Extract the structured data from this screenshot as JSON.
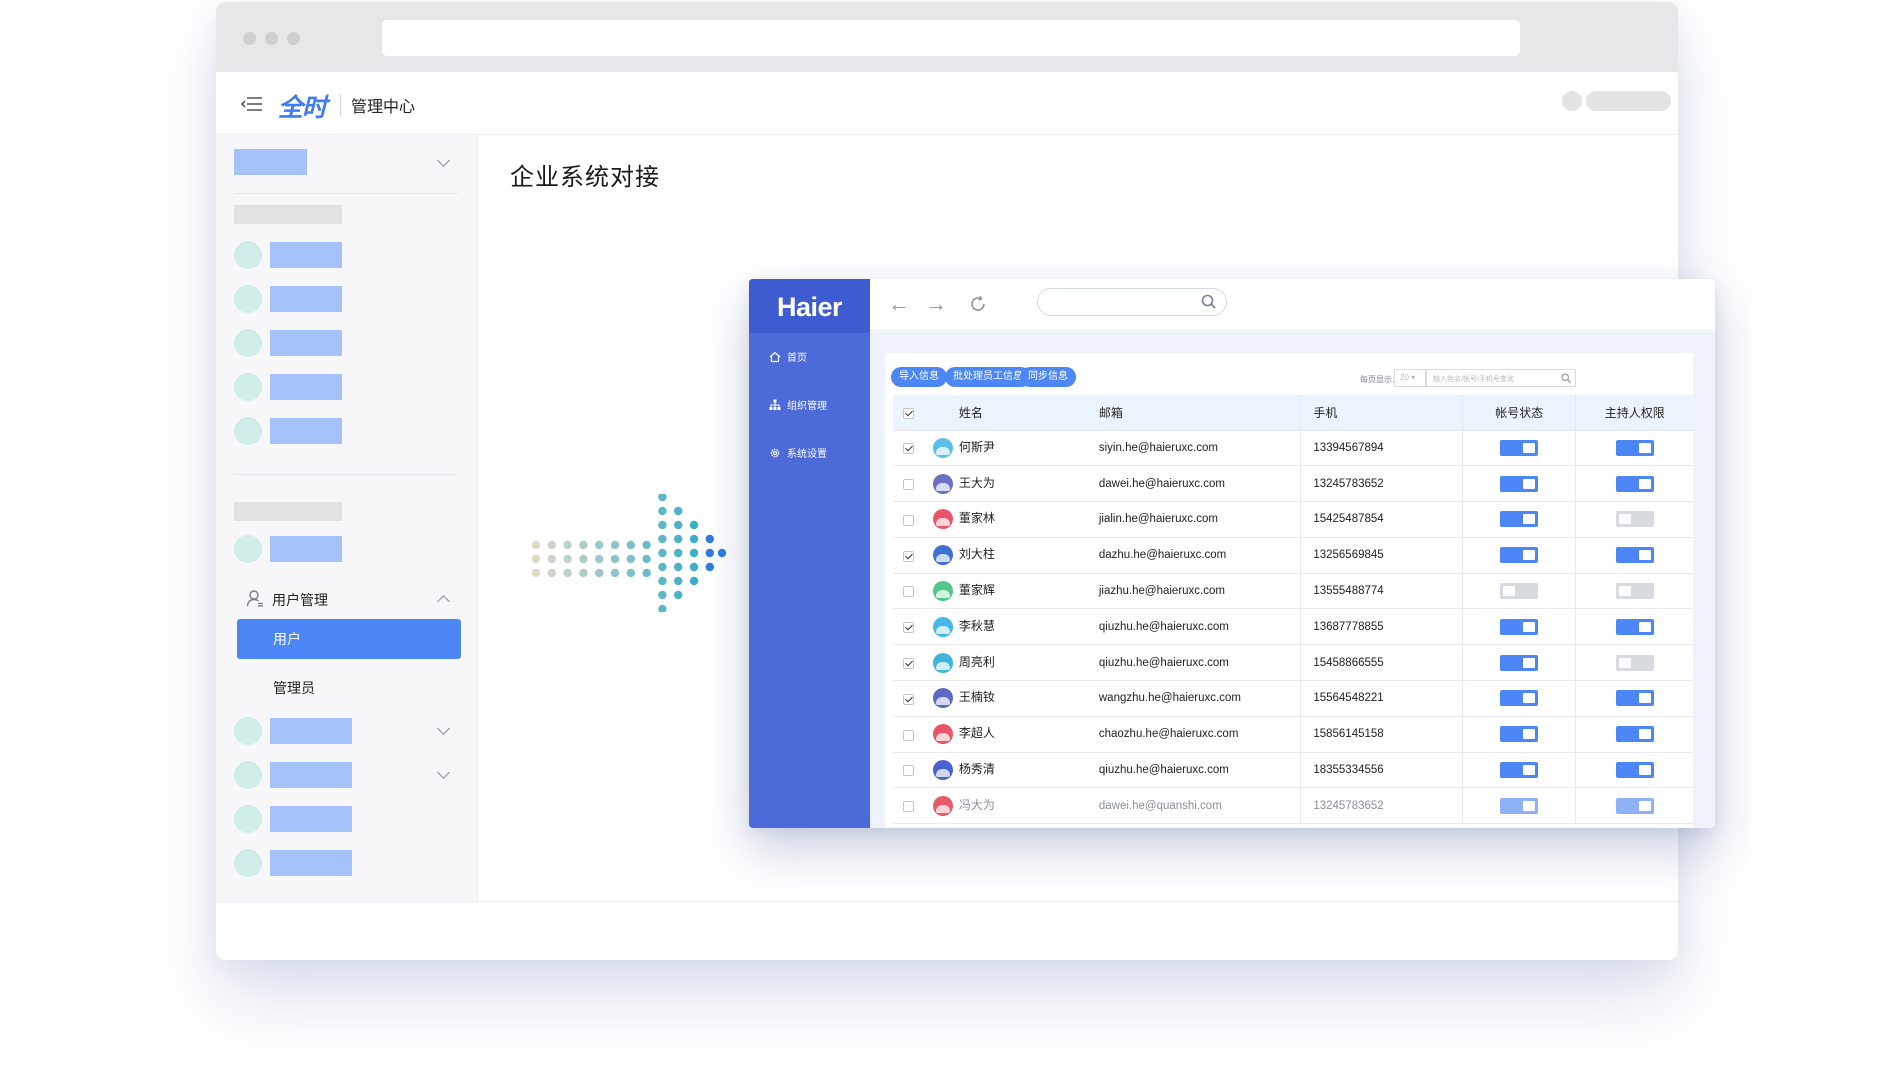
{
  "header": {
    "logo_text": "全时",
    "title": "管理中心"
  },
  "sidebar": {
    "user_mgmt_label": "用户管理",
    "active_item_label": "用户",
    "sub_item_label": "管理员"
  },
  "main": {
    "page_title": "企业系统对接"
  },
  "inner_app": {
    "logo": "Haier",
    "nav": [
      {
        "label": "首页",
        "icon": "home-icon"
      },
      {
        "label": "组织管理",
        "icon": "org-tree-icon"
      },
      {
        "label": "系统设置",
        "icon": "gear-icon"
      }
    ],
    "actions": [
      "导入信息",
      "批处理员工信息",
      "同步信息"
    ],
    "per_page_label": "每页显示：",
    "per_page_value": "20",
    "search_placeholder": "输入姓名/帐号/手机号查询",
    "columns": [
      "姓名",
      "邮箱",
      "手机",
      "帐号状态",
      "主持人权限"
    ],
    "rows": [
      {
        "checked": true,
        "name": "何斯尹",
        "email": "siyin.he@haieruxc.com",
        "phone": "13394567894",
        "account": true,
        "host": true,
        "avatar": "#5cc0e6"
      },
      {
        "checked": false,
        "name": "王大为",
        "email": "dawei.he@haieruxc.com",
        "phone": "13245783652",
        "account": true,
        "host": true,
        "avatar": "#6a6fc4"
      },
      {
        "checked": false,
        "name": "董家林",
        "email": "jialin.he@haieruxc.com",
        "phone": "15425487854",
        "account": true,
        "host": false,
        "avatar": "#e8556a"
      },
      {
        "checked": true,
        "name": "刘大柱",
        "email": "dazhu.he@haieruxc.com",
        "phone": "13256569845",
        "account": true,
        "host": true,
        "avatar": "#3e6fd6"
      },
      {
        "checked": false,
        "name": "董家辉",
        "email": "jiazhu.he@haieruxc.com",
        "phone": "13555488774",
        "account": false,
        "host": false,
        "avatar": "#52c78a"
      },
      {
        "checked": true,
        "name": "李秋慧",
        "email": "qiuzhu.he@haieruxc.com",
        "phone": "13687778855",
        "account": true,
        "host": true,
        "avatar": "#45b8e8"
      },
      {
        "checked": true,
        "name": "周亮利",
        "email": "qiuzhu.he@haieruxc.com",
        "phone": "15458866555",
        "account": true,
        "host": false,
        "avatar": "#3fb5d9"
      },
      {
        "checked": true,
        "name": "王楠钕",
        "email": "wangzhu.he@haieruxc.com",
        "phone": "15564548221",
        "account": true,
        "host": true,
        "avatar": "#5a69c6"
      },
      {
        "checked": false,
        "name": "李超人",
        "email": "chaozhu.he@haieruxc.com",
        "phone": "15856145158",
        "account": true,
        "host": true,
        "avatar": "#ea5463"
      },
      {
        "checked": false,
        "name": "杨秀清",
        "email": "qiuzhu.he@haieruxc.com",
        "phone": "18355334556",
        "account": true,
        "host": true,
        "avatar": "#4a62d0"
      },
      {
        "checked": false,
        "name": "冯大为",
        "email": "dawei.he@quanshi.com",
        "phone": "13245783652",
        "account": true,
        "host": true,
        "avatar": "#e85a6a"
      }
    ]
  },
  "colors": {
    "accent": "#4d86f5",
    "haier_sidebar": "#4d6ad9",
    "placeholder_block": "#a6c2fb",
    "placeholder_circle": "#cfeee9"
  }
}
